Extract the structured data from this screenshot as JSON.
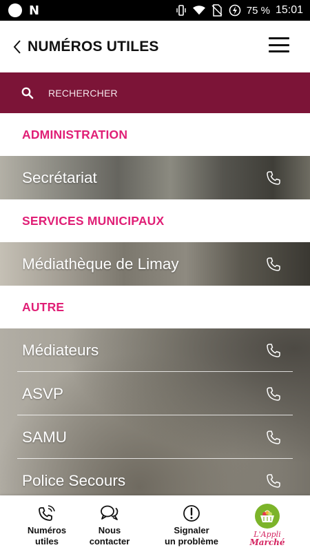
{
  "status_bar": {
    "battery": "75 %",
    "time": "15:01",
    "icons": [
      "circle-icon",
      "n-icon",
      "vibrate-icon",
      "wifi-icon",
      "no-sim-icon",
      "battery-saver-icon"
    ]
  },
  "header": {
    "title": "NUMÉROS UTILES",
    "back_icon": "chevron-left-icon",
    "menu_icon": "hamburger-icon"
  },
  "search": {
    "label": "RECHERCHER",
    "icon": "search-icon",
    "background": "#7c1437"
  },
  "accent_color": "#e01f76",
  "sections": [
    {
      "title": "ADMINISTRATION",
      "items": [
        {
          "label": "Secrétariat"
        }
      ]
    },
    {
      "title": "SERVICES MUNICIPAUX",
      "items": [
        {
          "label": "Médiathèque de Limay"
        }
      ]
    },
    {
      "title": "AUTRE",
      "items": [
        {
          "label": "Médiateurs"
        },
        {
          "label": "ASVP"
        },
        {
          "label": "SAMU"
        },
        {
          "label": "Police Secours"
        }
      ]
    }
  ],
  "bottom_nav": [
    {
      "label": "Numéros\nutiles",
      "icon": "phone-ringing-icon"
    },
    {
      "label": "Nous\ncontacter",
      "icon": "chat-bubbles-icon"
    },
    {
      "label": "Signaler\nun problème",
      "icon": "exclamation-circle-icon"
    }
  ],
  "logo": {
    "line1": "L'Appli",
    "line2": "Marché",
    "color": "#d4225f",
    "circle_color": "#7cb42a"
  }
}
